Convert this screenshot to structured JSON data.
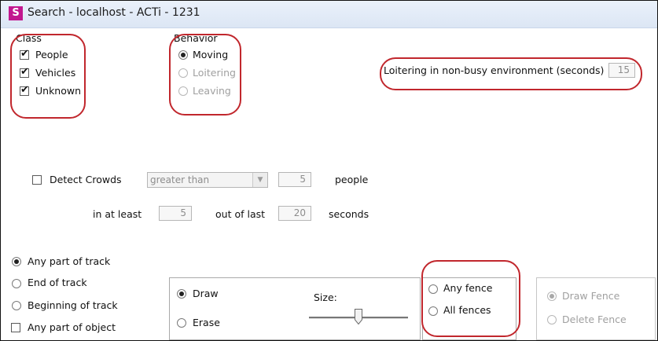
{
  "window": {
    "title": "Search - localhost - ACTi - 1231",
    "logo_letter": "S"
  },
  "class_group": {
    "label": "Class",
    "items": [
      {
        "label": "People",
        "checked": true
      },
      {
        "label": "Vehicles",
        "checked": true
      },
      {
        "label": "Unknown",
        "checked": true
      }
    ]
  },
  "behavior_group": {
    "label": "Behavior",
    "items": [
      {
        "label": "Moving",
        "selected": true,
        "enabled": true
      },
      {
        "label": "Loitering",
        "selected": false,
        "enabled": false
      },
      {
        "label": "Leaving",
        "selected": false,
        "enabled": false
      }
    ]
  },
  "loitering": {
    "label": "Loitering in non-busy environment (seconds)",
    "value": "15"
  },
  "crowds": {
    "checkbox_label": "Detect Crowds",
    "checked": false,
    "comparison": "greater than",
    "count": "5",
    "count_unit": "people",
    "at_least_label": "in at least",
    "at_least_value": "5",
    "out_of_label": "out of last",
    "out_of_value": "20",
    "seconds_label": "seconds"
  },
  "track": {
    "options": [
      {
        "label": "Any part of track",
        "selected": true
      },
      {
        "label": "End of track",
        "selected": false
      },
      {
        "label": "Beginning of track",
        "selected": false
      }
    ],
    "any_part_of_object": {
      "label": "Any part of object",
      "checked": false
    }
  },
  "draw_panel": {
    "draw_label": "Draw",
    "erase_label": "Erase",
    "mode": "Draw",
    "size_label": "Size:",
    "size_level": 0.5
  },
  "fence_group": {
    "any_fence_label": "Any fence",
    "all_fences_label": "All fences",
    "selected": null
  },
  "fence_tools": {
    "draw_fence_label": "Draw Fence",
    "delete_fence_label": "Delete Fence",
    "selected": "Draw Fence",
    "enabled": false
  },
  "annotation_color": "#c1272d"
}
